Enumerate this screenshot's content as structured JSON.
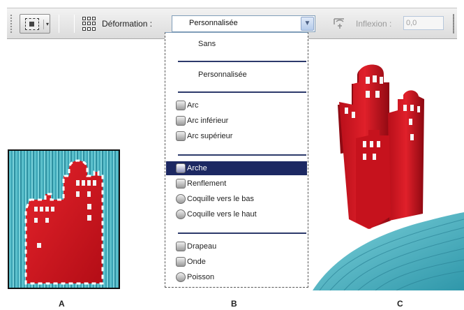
{
  "options_bar": {
    "tool_icon": "rect-marquee-icon",
    "warp_icon": "warp-grid-icon",
    "warp_label": "Déformation :",
    "warp_value": "Personnalisée",
    "dropdown_icon": "chevron-down-icon",
    "orientation_icon": "warp-orientation-icon",
    "inflexion_label": "Inflexion :",
    "inflexion_value": "0,0"
  },
  "menu": {
    "items": [
      {
        "label": "Sans",
        "icon": null
      },
      {
        "label": "Personnalisée",
        "icon": null
      },
      {
        "label": "Arc",
        "icon": "arc-icon"
      },
      {
        "label": "Arc inférieur",
        "icon": "arc-lower-icon"
      },
      {
        "label": "Arc supérieur",
        "icon": "arc-upper-icon"
      },
      {
        "label": "Arche",
        "icon": "arch-icon",
        "selected": true
      },
      {
        "label": "Renflement",
        "icon": "bulge-icon"
      },
      {
        "label": "Coquille vers le bas",
        "icon": "shell-lower-icon"
      },
      {
        "label": "Coquille vers le haut",
        "icon": "shell-upper-icon"
      },
      {
        "label": "Drapeau",
        "icon": "flag-icon"
      },
      {
        "label": "Onde",
        "icon": "wave-icon"
      },
      {
        "label": "Poisson",
        "icon": "fish-icon"
      }
    ]
  },
  "captions": {
    "a": "A",
    "b": "B",
    "c": "C"
  },
  "colors": {
    "highlight": "#1c2862",
    "building_red": "#d8141f",
    "teal": "#4fb6c4"
  }
}
